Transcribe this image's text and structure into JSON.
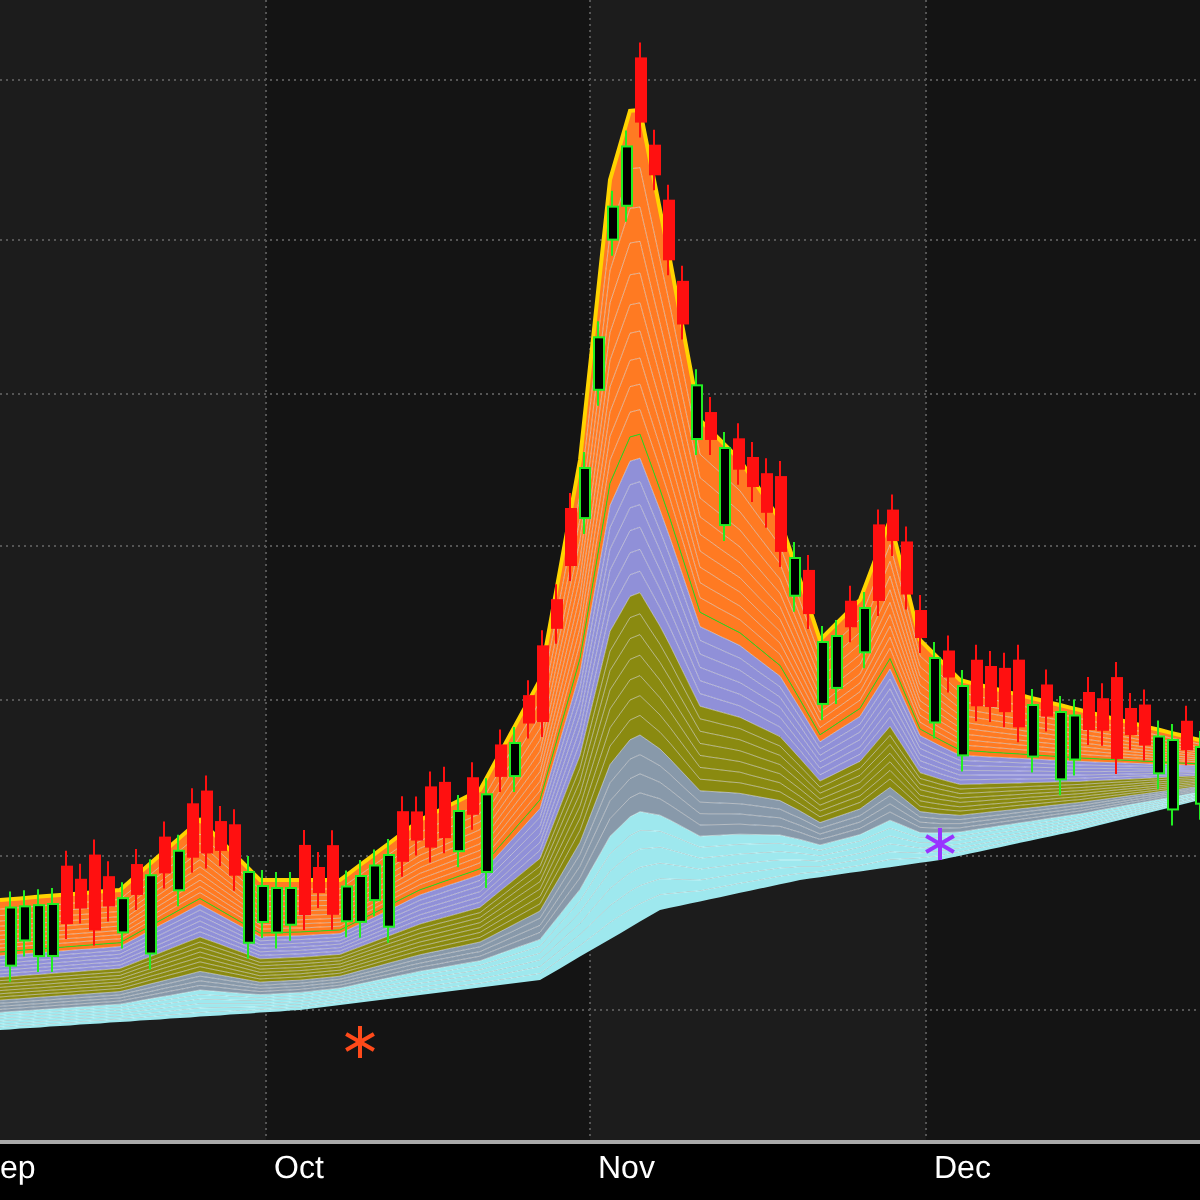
{
  "chart": {
    "axis_labels": [
      {
        "label": "ep"
      },
      {
        "label": "Oct"
      },
      {
        "label": "Nov"
      },
      {
        "label": "Dec"
      }
    ]
  }
}
